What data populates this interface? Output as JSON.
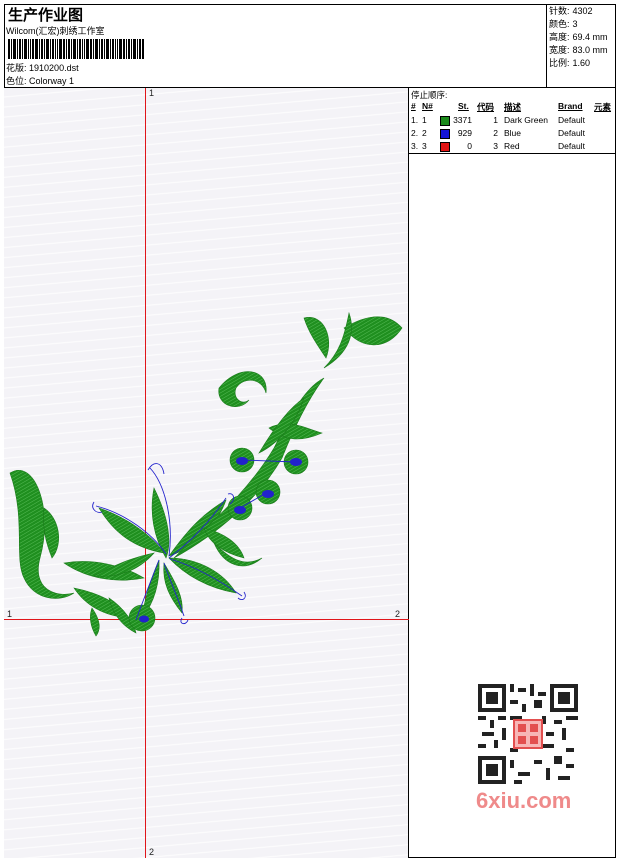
{
  "header": {
    "title": "生产作业图",
    "studio": "Wilcom(汇宏)刺绣工作室",
    "design_label": "花版:",
    "design_value": "1910200.dst",
    "colorway_label": "色位:",
    "colorway_value": "Colorway 1"
  },
  "stats": {
    "stitches_label": "针数:",
    "stitches_value": "4302",
    "colors_label": "颜色:",
    "colors_value": "3",
    "height_label": "高度:",
    "height_value": "69.4 mm",
    "width_label": "宽度:",
    "width_value": "83.0 mm",
    "scale_label": "比例:",
    "scale_value": "1.60"
  },
  "axes": {
    "top": "1",
    "bottom": "2",
    "left": "1",
    "right": "2"
  },
  "stop_sequence": {
    "title": "停止顺序:",
    "headers": [
      "#",
      "N#",
      "St.",
      "代码",
      "描述",
      "Brand",
      "元素"
    ],
    "rows": [
      {
        "idx": "1.",
        "n": "1",
        "color": "#1a8a1a",
        "st": "3371",
        "code": "1",
        "desc": "Dark Green",
        "brand": "Default"
      },
      {
        "idx": "2.",
        "n": "2",
        "color": "#1414d8",
        "st": "929",
        "code": "2",
        "desc": "Blue",
        "brand": "Default"
      },
      {
        "idx": "3.",
        "n": "3",
        "color": "#e01414",
        "st": "0",
        "code": "3",
        "desc": "Red",
        "brand": "Default"
      }
    ]
  },
  "colors": {
    "green": "#1f8f1f",
    "blue": "#2222cc",
    "red": "#e0151a"
  },
  "watermark": {
    "text": "6xiu.com"
  }
}
